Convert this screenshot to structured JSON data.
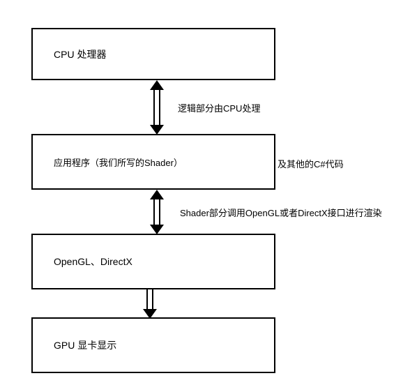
{
  "boxes": {
    "cpu": "CPU   处理器",
    "app": "应用程序（我们所写的Shader）",
    "app_suffix": "及其他的C#代码",
    "api": "OpenGL、DirectX",
    "gpu": "GPU 显卡显示"
  },
  "labels": {
    "logic": "逻辑部分由CPU处理",
    "shader": "Shader部分调用OpenGL或者DirectX接口进行渲染"
  },
  "chart_data": {
    "type": "flowchart",
    "nodes": [
      {
        "id": "cpu",
        "label": "CPU 处理器"
      },
      {
        "id": "app",
        "label": "应用程序（我们所写的Shader）及其他的C#代码"
      },
      {
        "id": "api",
        "label": "OpenGL、DirectX"
      },
      {
        "id": "gpu",
        "label": "GPU 显卡显示"
      }
    ],
    "edges": [
      {
        "from": "cpu",
        "to": "app",
        "direction": "bidirectional",
        "label": "逻辑部分由CPU处理"
      },
      {
        "from": "app",
        "to": "api",
        "direction": "bidirectional",
        "label": "Shader部分调用OpenGL或者DirectX接口进行渲染"
      },
      {
        "from": "api",
        "to": "gpu",
        "direction": "down",
        "label": ""
      }
    ]
  }
}
